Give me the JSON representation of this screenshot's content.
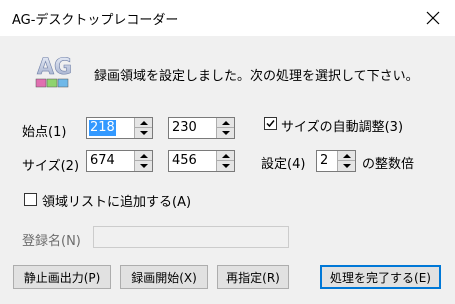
{
  "window": {
    "title": "AG-デスクトップレコーダー"
  },
  "logo": {
    "text": "AG"
  },
  "instruction": "録画領域を設定しました。次の処理を選択して下さい。",
  "start_point": {
    "label": "始点(1)",
    "x": "218",
    "y": "230"
  },
  "size": {
    "label": "サイズ(2)",
    "width": "674",
    "height": "456"
  },
  "auto_adjust": {
    "label": "サイズの自動調整(3)",
    "checked": true
  },
  "setting": {
    "label": "設定(4)",
    "value": "2",
    "suffix": "の整数倍"
  },
  "add_to_list": {
    "label": "領域リストに追加する(A)",
    "checked": false
  },
  "registered_name": {
    "label": "登録名(N)",
    "value": ""
  },
  "buttons": {
    "still_output": "静止画出力(P)",
    "start_recording": "録画開始(X)",
    "respecify": "再指定(R)",
    "finish": "処理を完了する(E)"
  },
  "colors": {
    "selection": "#3399ff",
    "default_button_border": "#0078d7"
  }
}
